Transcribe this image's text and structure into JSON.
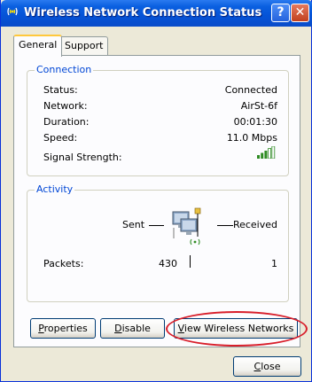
{
  "window": {
    "title": "Wireless Network Connection Status",
    "help_symbol": "?",
    "close_symbol": "✕"
  },
  "tabs": [
    {
      "label": "General"
    },
    {
      "label": "Support"
    }
  ],
  "connection": {
    "group_label": "Connection",
    "rows": [
      {
        "label": "Status:",
        "value": "Connected"
      },
      {
        "label": "Network:",
        "value": "AirSt-6f"
      },
      {
        "label": "Duration:",
        "value": "00:01:30"
      },
      {
        "label": "Speed:",
        "value": "11.0 Mbps"
      }
    ],
    "signal_label": "Signal Strength:",
    "signal_bars_filled": 3,
    "signal_bars_total": 5,
    "signal_color": "#2E8B22"
  },
  "activity": {
    "group_label": "Activity",
    "sent_label": "Sent",
    "received_label": "Received",
    "packets_label": "Packets:",
    "packets_sent": "430",
    "packets_received": "1"
  },
  "buttons": {
    "properties": {
      "accel": "P",
      "rest": "roperties"
    },
    "disable": {
      "accel": "D",
      "rest": "isable"
    },
    "view_networks": {
      "accel": "V",
      "rest": "iew Wireless Networks"
    },
    "close": {
      "accel": "C",
      "rest": "lose"
    }
  },
  "highlight_color": "#D81E2A"
}
